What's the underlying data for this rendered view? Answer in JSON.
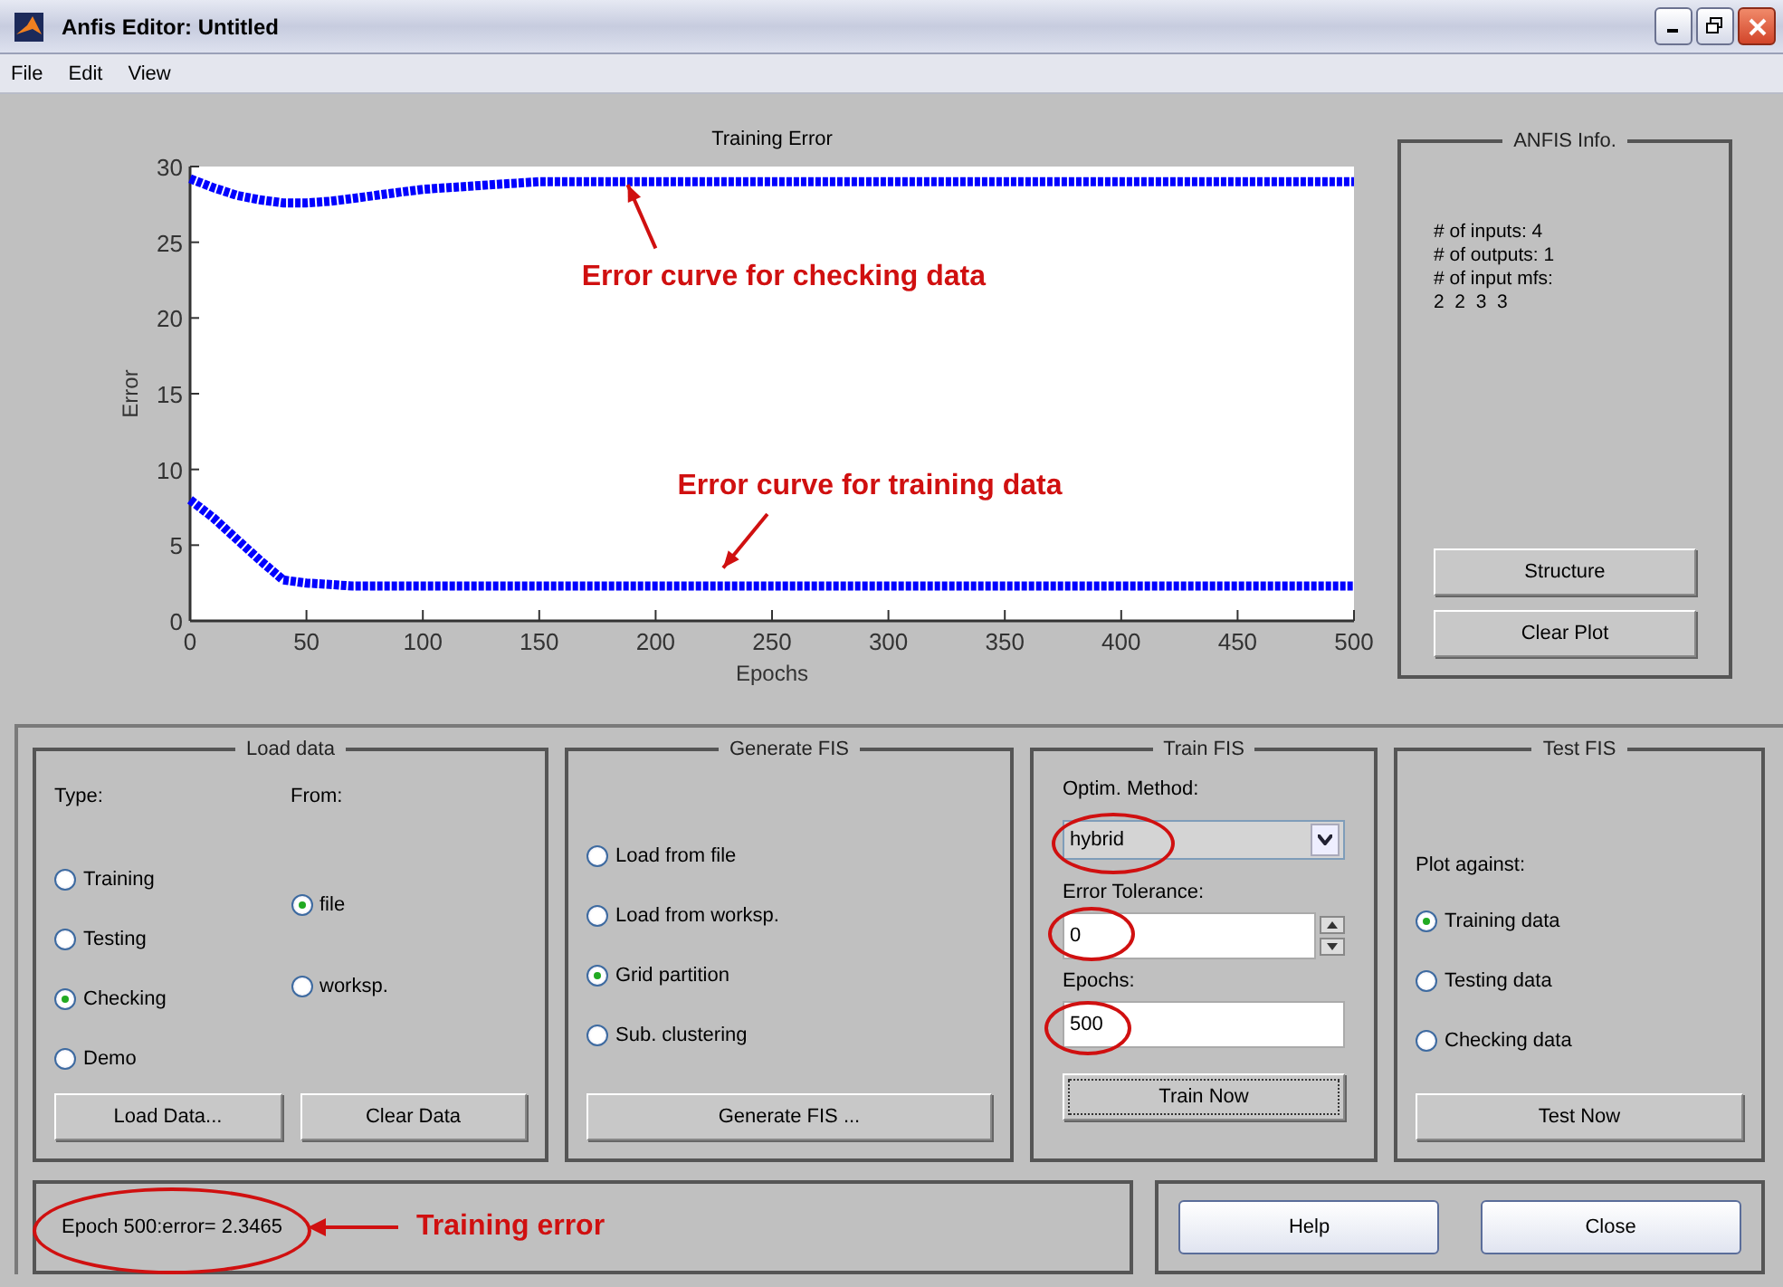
{
  "window": {
    "title": "Anfis Editor: Untitled"
  },
  "menu": [
    "File",
    "Edit",
    "View"
  ],
  "plot": {
    "chart_data": {
      "type": "line",
      "title": "Training Error",
      "xlabel": "Epochs",
      "ylabel": "Error",
      "x": [
        0,
        10,
        20,
        30,
        40,
        50,
        60,
        70,
        80,
        90,
        100,
        110,
        120,
        130,
        140,
        150,
        160,
        170,
        180,
        190,
        200,
        210,
        220,
        230,
        240,
        250,
        260,
        270,
        280,
        290,
        300,
        310,
        320,
        330,
        340,
        350,
        360,
        370,
        380,
        390,
        400,
        410,
        420,
        430,
        440,
        450,
        460,
        470,
        480,
        490,
        500
      ],
      "series": [
        {
          "color": "#0000ff",
          "line_style": "dashed",
          "values": [
            29.2,
            28.6,
            28.1,
            27.8,
            27.6,
            27.6,
            27.7,
            27.9,
            28.1,
            28.3,
            28.5,
            28.6,
            28.7,
            28.8,
            28.9,
            29,
            29,
            29,
            29,
            29,
            29,
            29,
            29,
            29,
            29,
            29,
            29,
            29,
            29,
            29,
            29,
            29,
            29,
            29,
            29,
            29,
            29,
            29,
            29,
            29,
            29,
            29,
            29,
            29,
            29,
            29,
            29,
            29,
            29,
            29,
            29
          ]
        },
        {
          "color": "#0000ff",
          "line_style": "dashed",
          "values": [
            8,
            6.8,
            5.4,
            4,
            2.7,
            2.5,
            2.4,
            2.3,
            2.3,
            2.3,
            2.3,
            2.3,
            2.3,
            2.3,
            2.3,
            2.3,
            2.3,
            2.3,
            2.3,
            2.3,
            2.3,
            2.3,
            2.3,
            2.3,
            2.3,
            2.3,
            2.3,
            2.3,
            2.3,
            2.3,
            2.3,
            2.3,
            2.3,
            2.3,
            2.3,
            2.3,
            2.3,
            2.3,
            2.3,
            2.3,
            2.3,
            2.3,
            2.3,
            2.3,
            2.3,
            2.3,
            2.3,
            2.3,
            2.3,
            2.3,
            2.3
          ]
        }
      ],
      "xlim": [
        0,
        500
      ],
      "ylim": [
        0,
        30
      ],
      "xticks": [
        0,
        50,
        100,
        150,
        200,
        250,
        300,
        350,
        400,
        450,
        500
      ],
      "yticks": [
        0,
        5,
        10,
        15,
        20,
        25,
        30
      ],
      "annotations": [
        "Error curve for checking data",
        "Error curve for training data"
      ]
    }
  },
  "anfis_info": {
    "title": "ANFIS Info.",
    "lines": [
      "# of inputs: 4",
      "# of outputs: 1",
      "# of input mfs:",
      "2  2  3  3"
    ],
    "buttons": [
      "Structure",
      "Clear Plot"
    ]
  },
  "load_data": {
    "title": "Load data",
    "type_label": "Type:",
    "from_label": "From:",
    "types": [
      {
        "label": "Training",
        "selected": false
      },
      {
        "label": "Testing",
        "selected": false
      },
      {
        "label": "Checking",
        "selected": true
      },
      {
        "label": "Demo",
        "selected": false
      }
    ],
    "sources": [
      {
        "label": "file",
        "selected": true
      },
      {
        "label": "worksp.",
        "selected": false
      }
    ],
    "buttons": [
      "Load Data...",
      "Clear Data"
    ]
  },
  "generate_fis": {
    "title": "Generate FIS",
    "options": [
      {
        "label": "Load from file",
        "selected": false
      },
      {
        "label": "Load from worksp.",
        "selected": false
      },
      {
        "label": "Grid partition",
        "selected": true
      },
      {
        "label": "Sub. clustering",
        "selected": false
      }
    ],
    "button": "Generate FIS ..."
  },
  "train_fis": {
    "title": "Train FIS",
    "method_label": "Optim. Method:",
    "method": {
      "value": "hybrid",
      "circled": true
    },
    "tolerance_label": "Error Tolerance:",
    "tolerance": {
      "value": "0",
      "circled": true
    },
    "epochs_label": "Epochs:",
    "epochs": {
      "value": "500",
      "circled": true
    },
    "button": "Train Now"
  },
  "test_fis": {
    "title": "Test FIS",
    "plot_label": "Plot against:",
    "options": [
      {
        "label": "Training data",
        "selected": true
      },
      {
        "label": "Testing data",
        "selected": false
      },
      {
        "label": "Checking data",
        "selected": false
      }
    ],
    "button": "Test Now"
  },
  "status": {
    "text": "Epoch 500:error= 2.3465",
    "circled": true,
    "callout": "Training error"
  },
  "buttons": [
    "Help",
    "Close"
  ]
}
